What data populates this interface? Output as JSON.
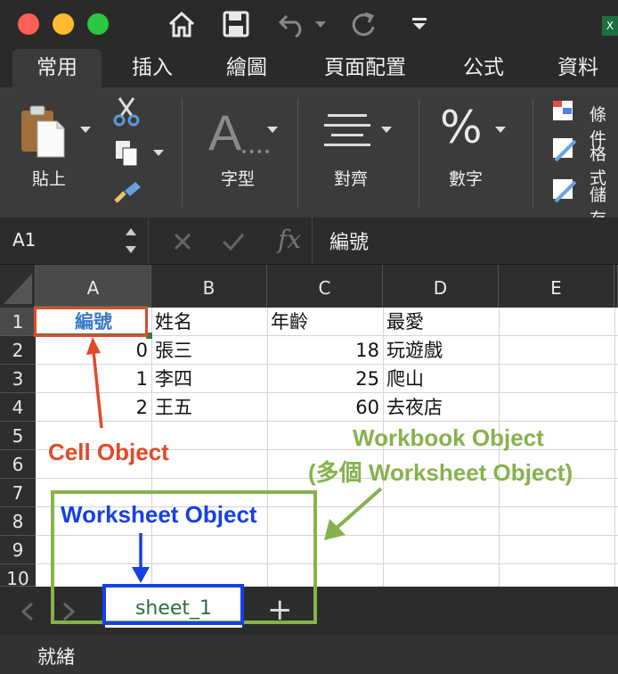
{
  "app": {
    "title_icon": "excel-app-icon"
  },
  "window": {
    "colors": {
      "close": "#fe5f57",
      "minimize": "#febc2e",
      "zoom": "#28c840"
    }
  },
  "ribbon_tabs": [
    "常用",
    "插入",
    "繪圖",
    "頁面配置",
    "公式",
    "資料"
  ],
  "active_tab": "常用",
  "ribbon": {
    "paste_label": "貼上",
    "font_label": "字型",
    "align_label": "對齊",
    "number_label": "數字",
    "number_symbol": "%",
    "side_items": [
      "條件",
      "格式",
      "儲存"
    ]
  },
  "formula_bar": {
    "name_box": "A1",
    "fx": "fx",
    "content": "編號"
  },
  "columns": [
    "A",
    "B",
    "C",
    "D",
    "E"
  ],
  "rows": [
    "1",
    "2",
    "3",
    "4",
    "5",
    "6",
    "7",
    "8",
    "9",
    "10"
  ],
  "cells": {
    "r1": [
      "編號",
      "姓名",
      "年齡",
      "最愛"
    ],
    "r2": [
      "0",
      "張三",
      "18",
      "玩遊戲"
    ],
    "r3": [
      "1",
      "李四",
      "25",
      "爬山"
    ],
    "r4": [
      "2",
      "王五",
      "60",
      "去夜店"
    ]
  },
  "annotations": {
    "cell_object": "Cell Object",
    "workbook_object": "Workbook Object",
    "workbook_sub": "(多個 Worksheet Object)",
    "worksheet_object": "Worksheet Object",
    "colors": {
      "cell": "#e04a2a",
      "workbook": "#86b24e",
      "worksheet": "#1540e8",
      "header_text": "#3a78c8"
    }
  },
  "sheet_tabs": {
    "active": "sheet_1",
    "add": "+"
  },
  "status": "就緒"
}
